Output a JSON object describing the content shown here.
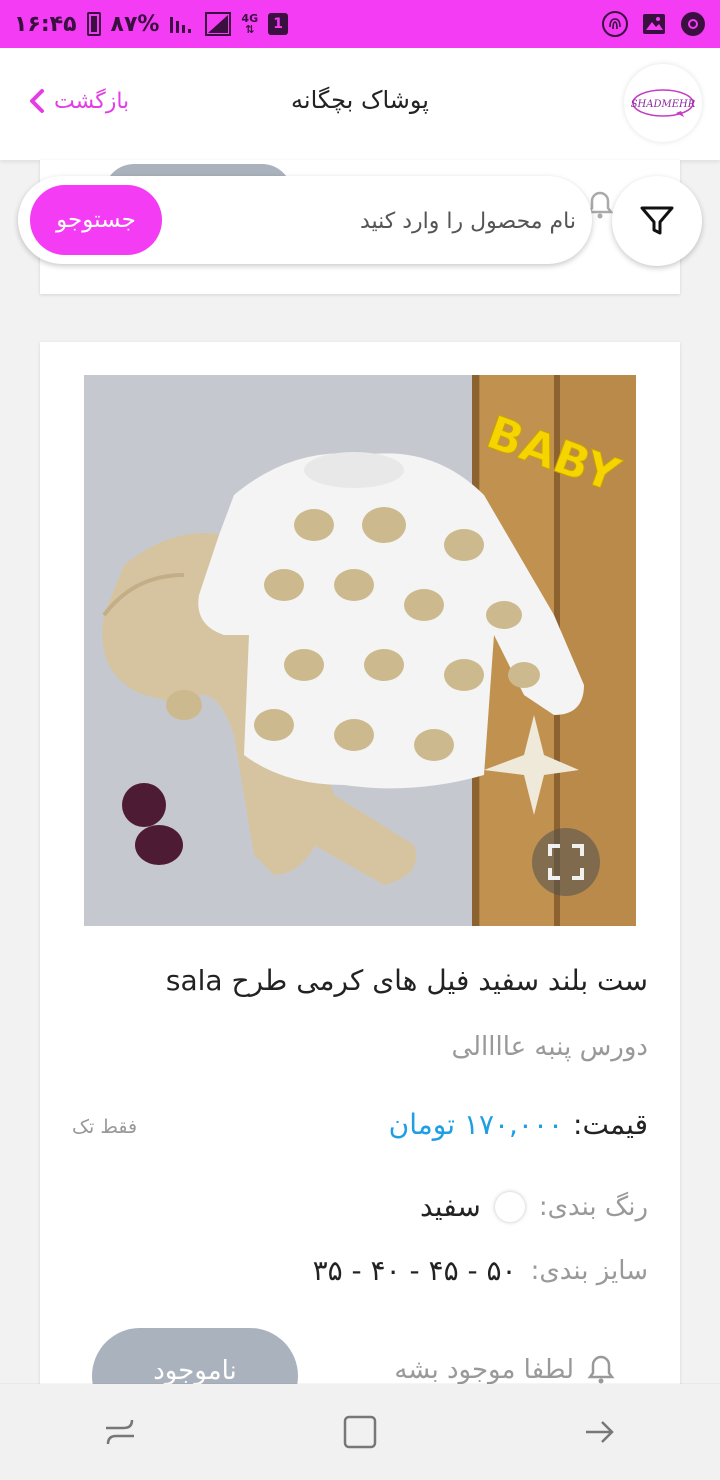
{
  "status_bar": {
    "time": "۱۶:۴۵",
    "battery": "۸۷%",
    "network": "4G",
    "sim_slot": "1",
    "icons": [
      "battery-icon",
      "signal-icon",
      "network-4g-icon",
      "sim-icon",
      "fingerprint-icon",
      "gallery-icon",
      "chrome-icon"
    ]
  },
  "header": {
    "title": "پوشاک بچگانه",
    "back_label": "بازگشت",
    "logo_text": "SHADMEHR"
  },
  "search": {
    "placeholder": "نام محصول را وارد کنید",
    "button_label": "جستوجو"
  },
  "product": {
    "title": "ست بلند سفید فیل های کرمی طرح sala",
    "subtitle": "دورس پنبه عاااالی",
    "price_label": "قیمت:",
    "price_value": "۱۷۰,۰۰۰ تومان",
    "sale_type": "فقط تک",
    "color_label": "رنگ بندی:",
    "color_value": "سفید",
    "color_swatch": "#ffffff",
    "size_label": "سایز بندی:",
    "size_value": "۳۵ - ۴۰ - ۴۵ - ۵۰",
    "notify_label": "لطفا موجود بشه",
    "unavailable_label": "ناموجود"
  },
  "image_text": {
    "baby": "BABY"
  },
  "colors": {
    "accent": "#f43cf4",
    "price": "#1e9fe3",
    "disabled": "#aab2bd"
  }
}
